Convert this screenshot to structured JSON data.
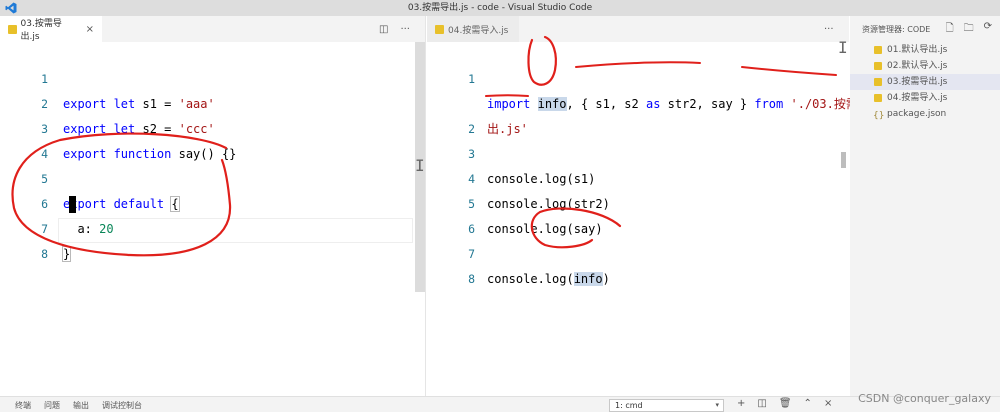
{
  "window": {
    "title": "03.按需导出.js - code - Visual Studio Code"
  },
  "left_editor": {
    "tab": {
      "label": "03.按需导出.js",
      "close": "×"
    },
    "actions": {
      "split": "◫",
      "more": "···"
    },
    "line_numbers": [
      "1",
      "2",
      "3",
      "4",
      "5",
      "6",
      "7",
      "8"
    ],
    "code": {
      "l1_kw": "export let",
      "l1_rest": " s1 = ",
      "l1_str": "'aaa'",
      "l2_kw": "export let",
      "l2_rest": " s2 = ",
      "l2_str": "'ccc'",
      "l3_kw": "export function",
      "l3_rest": " say() {}",
      "l5_kw": "export default",
      "l5_sp": " ",
      "l5_brace": "{",
      "l6_key": "  a: ",
      "l6_num": "20",
      "l7_brace": "}"
    }
  },
  "right_editor": {
    "tab": {
      "label": "04.按需导入.js"
    },
    "actions": {
      "more": "···"
    },
    "line_numbers": [
      "1",
      "",
      "2",
      "3",
      "4",
      "5",
      "6",
      "7",
      "8"
    ],
    "code": {
      "l1_import": "import",
      "l1_sp": " ",
      "l1_info": "info",
      "l1_mid": ", { s1, s2 ",
      "l1_as": "as",
      "l1_tail": " str2, say } ",
      "l1_from": "from",
      "l1_sp2": " ",
      "l1_path": "'./03.按需导",
      "l1_path2": "出.js'",
      "l3": "console.log(s1)",
      "l4": "console.log(str2)",
      "l5": "console.log(say)",
      "l7_pre": "console.log(",
      "l7_info": "info",
      "l7_post": ")"
    }
  },
  "explorer": {
    "header": "资源管理器: CODE",
    "actions": {
      "new_file": "🗋",
      "new_folder": "🗀",
      "collapse": "⟳"
    },
    "files": [
      {
        "label": "01.默认导出.js",
        "type": "js"
      },
      {
        "label": "02.默认导入.js",
        "type": "js"
      },
      {
        "label": "03.按需导出.js",
        "type": "js",
        "active": true
      },
      {
        "label": "04.按需导入.js",
        "type": "js"
      },
      {
        "label": "package.json",
        "type": "json"
      }
    ]
  },
  "panel": {
    "tabs": [
      "终端",
      "问题",
      "输出",
      "调试控制台"
    ],
    "terminal_select": "1: cmd",
    "actions": {
      "add": "+",
      "split": "◫",
      "trash": "🗑",
      "up": "⌃",
      "close": "×"
    }
  },
  "watermark": "CSDN @conquer_galaxy",
  "colors": {
    "keyword": "#0000ff",
    "string": "#a31515",
    "number": "#098658",
    "line_number": "#237893",
    "annotation": "#e0201b",
    "js_icon": "#e8c02a"
  }
}
